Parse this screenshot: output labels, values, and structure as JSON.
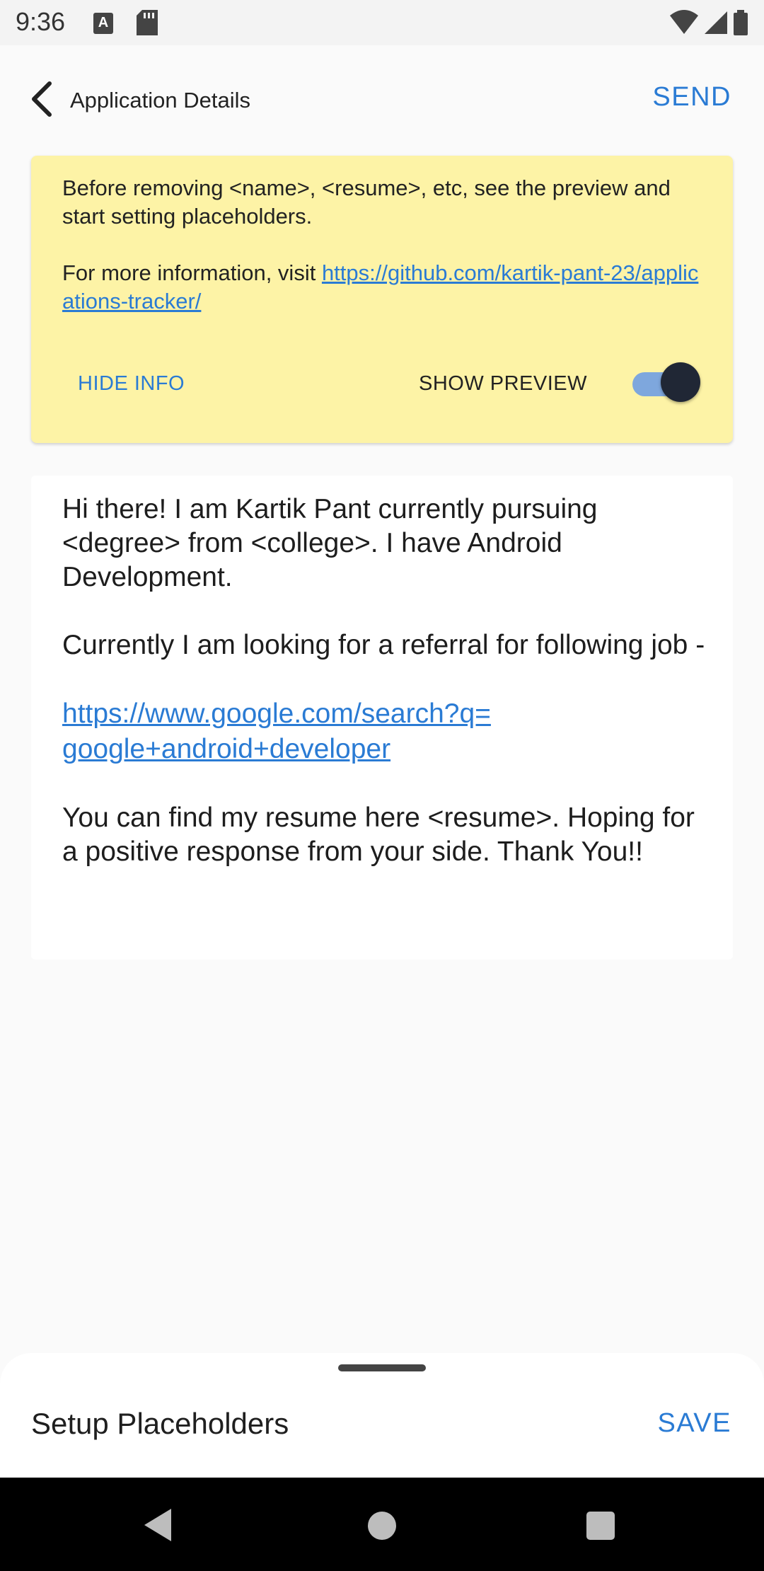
{
  "status_bar": {
    "time": "9:36",
    "icons": [
      "a-notification-icon",
      "sd-card-icon",
      "wifi-icon",
      "cell-signal-icon",
      "battery-icon"
    ]
  },
  "header": {
    "back_icon": "chevron-left-icon",
    "title": "Application Details",
    "send_label": "SEND"
  },
  "info_card": {
    "line1": "Before removing <name>, <resume>, etc, see the preview and start setting placeholders.",
    "line2_prefix": "For more information, visit ",
    "link": "https://github.com/kartik-pant-23/applications-tracker/",
    "hide_info_label": "HIDE INFO",
    "show_preview_label": "SHOW PREVIEW",
    "show_preview_enabled": true
  },
  "message": {
    "paragraph1": "Hi there! I am Kartik Pant currently pursuing <degree> from <college>. I have Android Development.",
    "paragraph2": "Currently I am looking for a referral for following job -",
    "link_line1": "https://www.google.com/search?q=",
    "link_line2": "google+android+developer",
    "paragraph3": "You can find my resume here <resume>. Hoping for a positive response from your side. Thank You!!"
  },
  "bottom_sheet": {
    "title": "Setup Placeholders",
    "save_label": "SAVE"
  },
  "colors": {
    "accent": "#2a7bd4",
    "info_background": "#fdf3a6",
    "toggle_knob": "#202735",
    "toggle_track": "#7ea7dd"
  }
}
